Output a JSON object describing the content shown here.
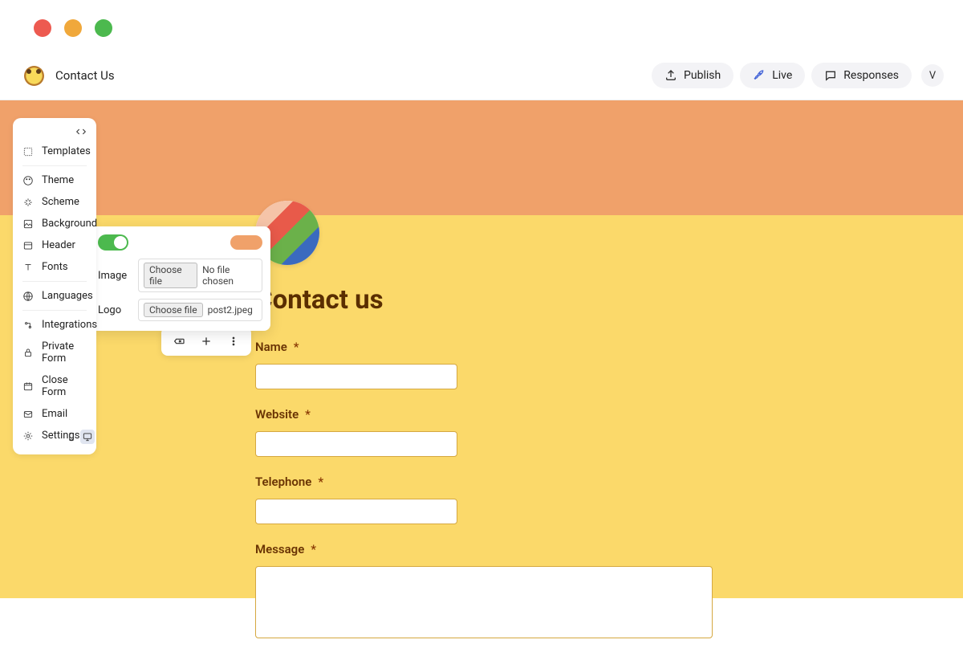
{
  "app_title": "Contact Us",
  "user_initial": "V",
  "buttons": {
    "publish": "Publish",
    "live": "Live",
    "responses": "Responses"
  },
  "sidebar": {
    "templates": "Templates",
    "theme": "Theme",
    "scheme": "Scheme",
    "background": "Background",
    "header": "Header",
    "fonts": "Fonts",
    "languages": "Languages",
    "integrations": "Integrations",
    "private_form": "Private Form",
    "close_form": "Close Form",
    "email": "Email",
    "settings": "Settings"
  },
  "popover": {
    "image_label": "Image",
    "logo_label": "Logo",
    "choose_file": "Choose file",
    "no_file": "No file chosen",
    "logo_file": "post2.jpeg",
    "header_color": "#f0a16a"
  },
  "form": {
    "title": "Contact us",
    "fields": {
      "name": "Name",
      "website": "Website",
      "telephone": "Telephone",
      "message": "Message"
    },
    "required": "*"
  }
}
